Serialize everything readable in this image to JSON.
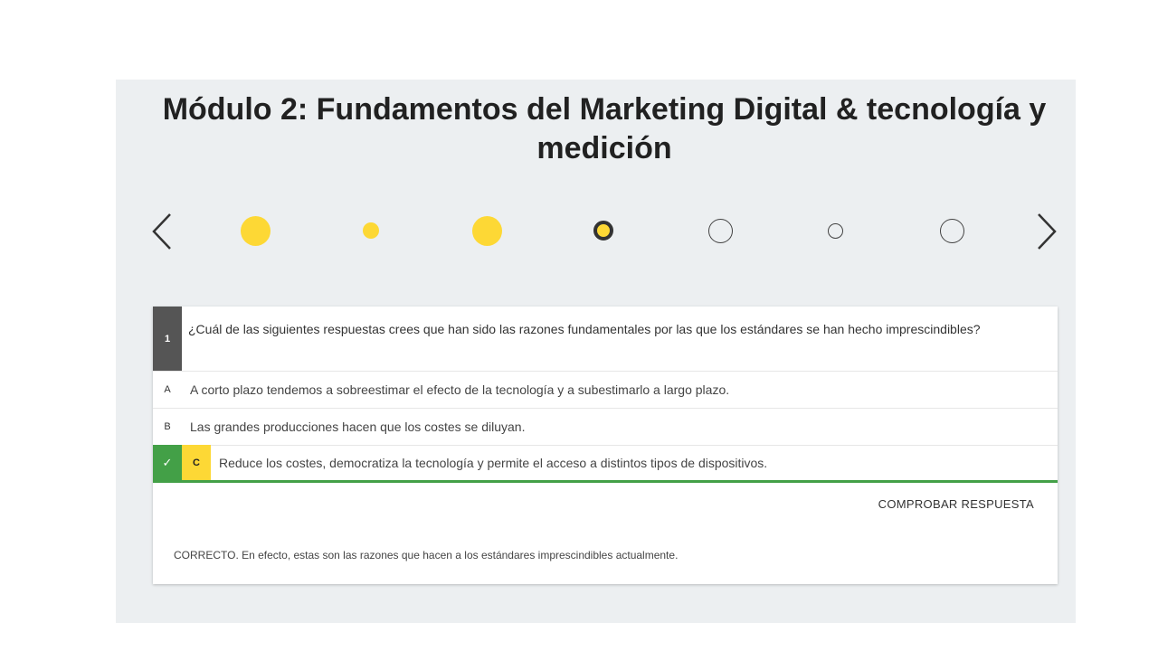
{
  "title": "Módulo 2: Fundamentos del Marketing Digital & tecnología y medición",
  "nav": {
    "prev_icon": "chevron-left-icon",
    "next_icon": "chevron-right-icon",
    "dots": [
      {
        "state": "answered"
      },
      {
        "state": "answered"
      },
      {
        "state": "answered"
      },
      {
        "state": "current"
      },
      {
        "state": "unanswered"
      },
      {
        "state": "unanswered"
      },
      {
        "state": "unanswered"
      }
    ]
  },
  "question": {
    "number": "1",
    "text": "¿Cuál de las siguientes respuestas crees que han sido las razones fundamentales por las que los estándares se han hecho imprescindibles?",
    "options": [
      {
        "letter": "A",
        "text": "A corto plazo tendemos a sobreestimar el efecto de la tecnología y a subestimarlo a largo plazo."
      },
      {
        "letter": "B",
        "text": "Las grandes producciones hacen que los costes se diluyan."
      },
      {
        "letter": "C",
        "text": "Reduce los costes, democratiza la tecnología y permite el acceso a distintos tipos de dispositivos.",
        "selected": true,
        "correct": true
      }
    ],
    "check_label": "COMPROBAR RESPUESTA",
    "feedback": "CORRECTO. En efecto, estas son las razones que hacen a los estándares imprescindibles actualmente."
  },
  "colors": {
    "panel_bg": "#eceff1",
    "accent_yellow": "#fdd835",
    "correct_green": "#43a047",
    "question_num_bg": "#555555"
  }
}
